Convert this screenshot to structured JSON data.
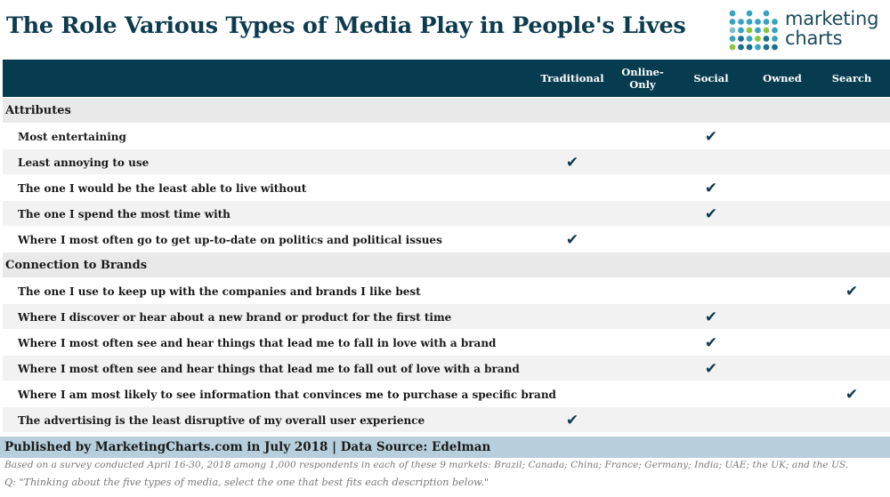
{
  "title": "The Role Various Types of Media Play in People's Lives",
  "logo": {
    "line1": "marketing",
    "line2": "charts",
    "colors": [
      "#7fbfd3",
      "#3aa3c2",
      "#8dc63f",
      "#1b6f8f"
    ]
  },
  "colors": {
    "header_bg": "#063b50",
    "title": "#0e3c4f",
    "section_bg": "#e9e9e9",
    "stripe_bg": "#f2f2f2",
    "footer_bg": "#b7cfdc",
    "check": "#0d3a4c"
  },
  "chart_data": {
    "type": "table",
    "check_symbol": "✔",
    "columns": [
      "Traditional",
      "Online-Only",
      "Social",
      "Owned",
      "Search"
    ],
    "sections": [
      {
        "name": "Attributes",
        "rows": [
          {
            "label": "Most entertaining",
            "checks": [
              false,
              false,
              true,
              false,
              false
            ]
          },
          {
            "label": "Least annoying to use",
            "checks": [
              true,
              false,
              false,
              false,
              false
            ]
          },
          {
            "label": "The one I would be the least able to live without",
            "checks": [
              false,
              false,
              true,
              false,
              false
            ]
          },
          {
            "label": "The one I spend the most time with",
            "checks": [
              false,
              false,
              true,
              false,
              false
            ]
          },
          {
            "label": "Where I most often go to get up-to-date on politics and political issues",
            "checks": [
              true,
              false,
              false,
              false,
              false
            ]
          }
        ]
      },
      {
        "name": "Connection to Brands",
        "rows": [
          {
            "label": "The one I use to keep up with the companies and brands I like best",
            "checks": [
              false,
              false,
              false,
              false,
              true
            ]
          },
          {
            "label": "Where I discover or hear about a new brand or product for the first time",
            "checks": [
              false,
              false,
              true,
              false,
              false
            ]
          },
          {
            "label": "Where I most often see and hear things that lead me to fall in love with a brand",
            "checks": [
              false,
              false,
              true,
              false,
              false
            ]
          },
          {
            "label": "Where I most often see and hear things that lead me to fall out of love with a brand",
            "checks": [
              false,
              false,
              true,
              false,
              false
            ]
          },
          {
            "label": "Where I am most likely to see information that convinces me to purchase a specific brand",
            "checks": [
              false,
              false,
              false,
              false,
              true
            ]
          },
          {
            "label": "The advertising is the least disruptive of my overall user experience",
            "checks": [
              true,
              false,
              false,
              false,
              false
            ]
          }
        ]
      }
    ]
  },
  "footer": {
    "published": "Published by MarketingCharts.com in July 2018 | Data Source: Edelman",
    "note1": "Based on a survey conducted April 16-30, 2018 among 1,000 respondents in each of these 9 markets: Brazil; Canada; China; France; Germany; India; UAE; the UK; and the US.",
    "note2": "Q: \"Thinking about the five types of media, select the one that best fits each description below.\""
  }
}
